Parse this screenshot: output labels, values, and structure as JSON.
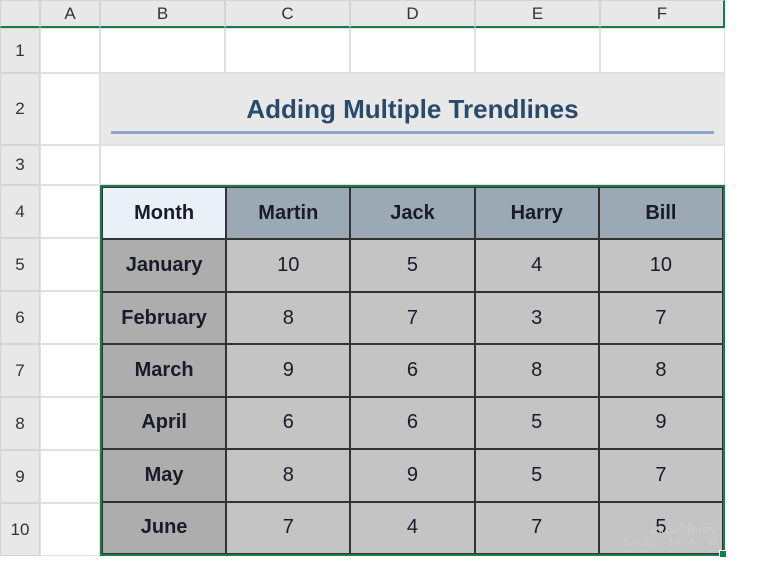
{
  "columns": [
    "A",
    "B",
    "C",
    "D",
    "E",
    "F"
  ],
  "rows": [
    "1",
    "2",
    "3",
    "4",
    "5",
    "6",
    "7",
    "8",
    "9",
    "10"
  ],
  "title": "Adding Multiple Trendlines",
  "table": {
    "corner": "Month",
    "headers": [
      "Martin",
      "Jack",
      "Harry",
      "Bill"
    ],
    "months": [
      "January",
      "February",
      "March",
      "April",
      "May",
      "June"
    ],
    "data": [
      [
        10,
        5,
        4,
        10
      ],
      [
        8,
        7,
        3,
        7
      ],
      [
        9,
        6,
        8,
        8
      ],
      [
        6,
        6,
        5,
        9
      ],
      [
        8,
        9,
        5,
        7
      ],
      [
        7,
        4,
        7,
        5
      ]
    ]
  },
  "watermark": {
    "brand": "exceldemy",
    "tag": "EXCEL · DATA · BI"
  },
  "chart_data": {
    "type": "table",
    "title": "Adding Multiple Trendlines",
    "categories": [
      "January",
      "February",
      "March",
      "April",
      "May",
      "June"
    ],
    "series": [
      {
        "name": "Martin",
        "values": [
          10,
          8,
          9,
          6,
          8,
          7
        ]
      },
      {
        "name": "Jack",
        "values": [
          5,
          7,
          6,
          6,
          9,
          4
        ]
      },
      {
        "name": "Harry",
        "values": [
          4,
          3,
          8,
          5,
          5,
          7
        ]
      },
      {
        "name": "Bill",
        "values": [
          10,
          7,
          8,
          9,
          7,
          5
        ]
      }
    ],
    "xlabel": "Month",
    "ylabel": ""
  }
}
